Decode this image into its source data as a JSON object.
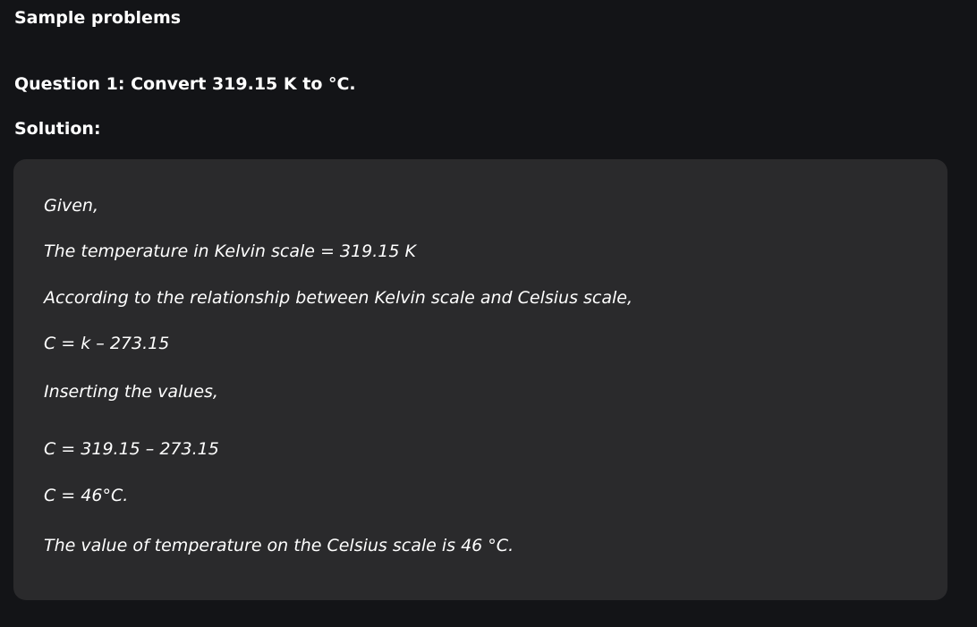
{
  "section": {
    "title": "Sample problems"
  },
  "question": {
    "text": "Question 1: Convert 319.15 K to °C."
  },
  "solution": {
    "label": "Solution:",
    "lines": [
      "Given,",
      "The temperature in Kelvin scale = 319.15 K",
      "According to the relationship between Kelvin scale and Celsius scale,",
      "C = k – 273.15",
      "Inserting the values,",
      "C = 319.15 – 273.15",
      "C = 46°C.",
      "The value of temperature on the Celsius scale is 46 °C."
    ]
  },
  "colors": {
    "page_background": "#131417",
    "box_background": "#2a2a2c",
    "text": "#ffffff"
  }
}
